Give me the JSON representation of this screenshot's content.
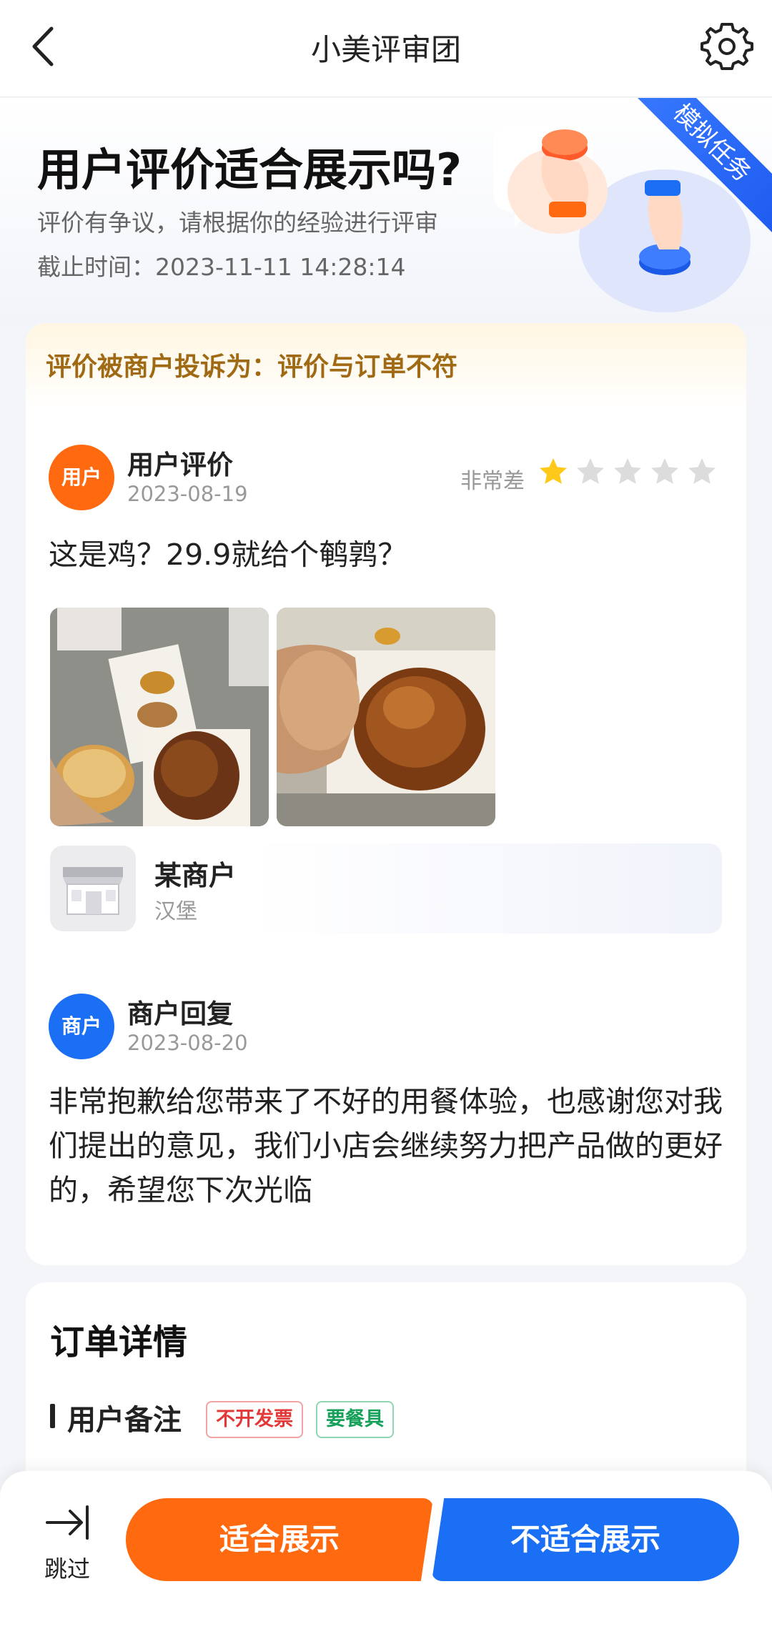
{
  "nav": {
    "title": "小美评审团",
    "back_icon": "chevron-left-icon",
    "settings_icon": "gear-icon"
  },
  "hero": {
    "title": "用户评价适合展示吗?",
    "subtitle": "评价有争议，请根据你的经验进行评审",
    "deadline": "截止时间：2023-11-11 14:28:14",
    "ribbon": "模拟任务"
  },
  "complaint": {
    "text": "评价被商户投诉为：评价与订单不符"
  },
  "review": {
    "avatar_label": "用户",
    "author": "用户评价",
    "date": "2023-08-19",
    "rating_label": "非常差",
    "rating": 1,
    "rating_max": 5,
    "text": "这是鸡？29.9就给个鹌鹑？"
  },
  "merchant": {
    "name": "某商户",
    "category": "汉堡"
  },
  "reply": {
    "avatar_label": "商户",
    "author": "商户回复",
    "date": "2023-08-20",
    "text": "非常抱歉给您带来了不好的用餐体验，也感谢您对我们提出的意见，我们小店会继续努力把产品做的更好的，希望您下次光临"
  },
  "order": {
    "title": "订单详情",
    "remark_label": "用户备注",
    "tags": [
      "不开发票",
      "要餐具"
    ]
  },
  "actions": {
    "skip_label": "跳过",
    "suitable_label": "适合展示",
    "unsuitable_label": "不适合展示"
  },
  "colors": {
    "accent_orange": "#ff6a10",
    "accent_blue": "#1a6ff5",
    "star_filled": "#ffc91a",
    "star_empty": "#dcdcdc"
  }
}
